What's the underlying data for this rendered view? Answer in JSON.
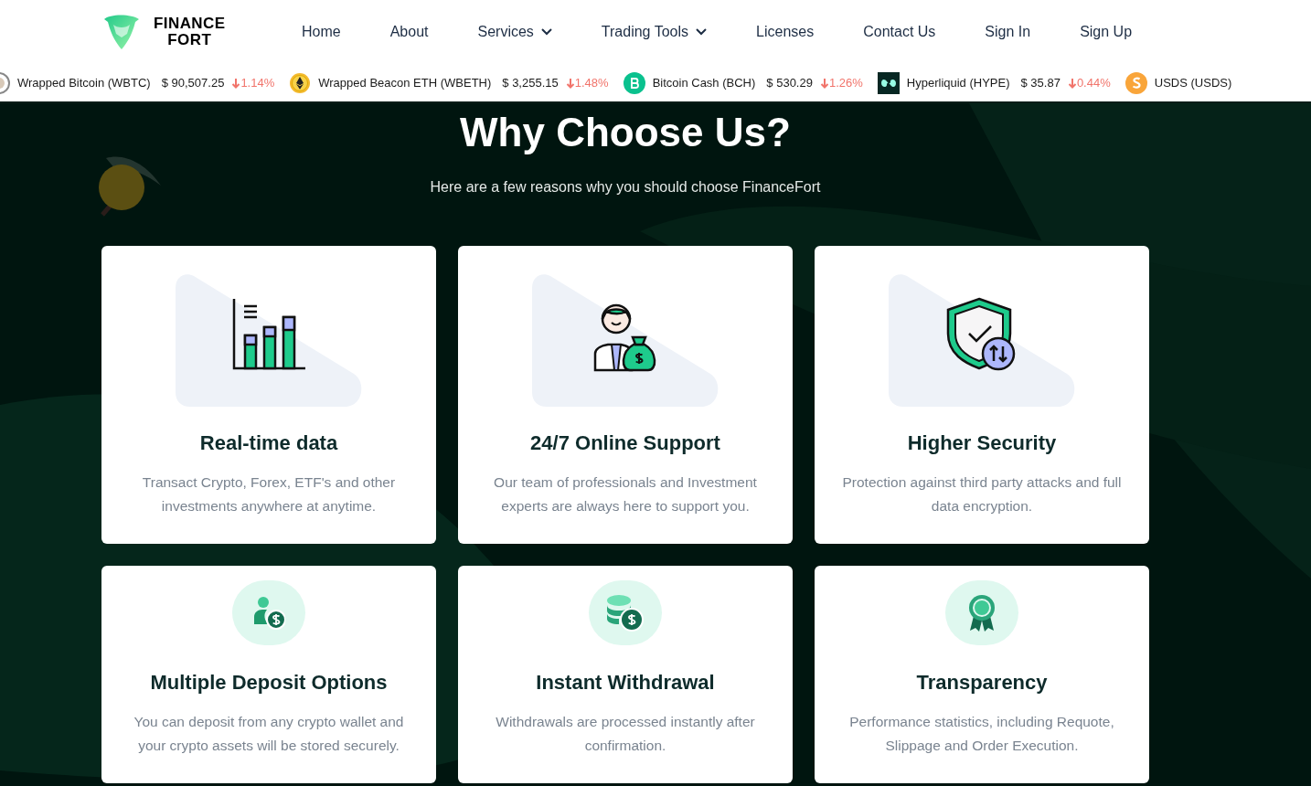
{
  "brand": {
    "line1": "FINANCE",
    "line2": "FORT"
  },
  "nav": [
    {
      "label": "Home",
      "dropdown": false
    },
    {
      "label": "About",
      "dropdown": false
    },
    {
      "label": "Services",
      "dropdown": true
    },
    {
      "label": "Trading Tools",
      "dropdown": true
    },
    {
      "label": "Licenses",
      "dropdown": false
    },
    {
      "label": "Contact Us",
      "dropdown": false
    },
    {
      "label": "Sign In",
      "dropdown": false
    },
    {
      "label": "Sign Up",
      "dropdown": false
    }
  ],
  "ticker": [
    {
      "name": "Wrapped Bitcoin (WBTC)",
      "price": "$ 90,507.25",
      "change": "1.14%"
    },
    {
      "name": "Wrapped Beacon ETH (WBETH)",
      "price": "$ 3,255.15",
      "change": "1.48%"
    },
    {
      "name": "Bitcoin Cash (BCH)",
      "price": "$ 530.29",
      "change": "1.26%"
    },
    {
      "name": "Hyperliquid (HYPE)",
      "price": "$ 35.87",
      "change": "0.44%"
    },
    {
      "name": "USDS (USDS)"
    }
  ],
  "section": {
    "title": "Why Choose Us?",
    "subtitle": "Here are a few reasons why you should choose FinanceFort"
  },
  "cards": [
    {
      "kind": "illustration",
      "title": "Real-time data",
      "text": "Transact Crypto, Forex, ETF's and other investments anywhere at anytime."
    },
    {
      "kind": "illustration",
      "title": "24/7 Online Support",
      "text": "Our team of professionals and Investment experts are always here to support you."
    },
    {
      "kind": "illustration",
      "title": "Higher Security",
      "text": "Protection against third party attacks and full data encryption."
    },
    {
      "kind": "badge",
      "title": "Multiple Deposit Options",
      "text": "You can deposit from any crypto wallet and your crypto assets will be stored securely."
    },
    {
      "kind": "badge",
      "title": "Instant Withdrawal",
      "text": "Withdrawals are processed instantly after confirmation."
    },
    {
      "kind": "badge",
      "title": "Transparency",
      "text": "Performance statistics, including Requote, Slippage and Order Execution."
    }
  ]
}
